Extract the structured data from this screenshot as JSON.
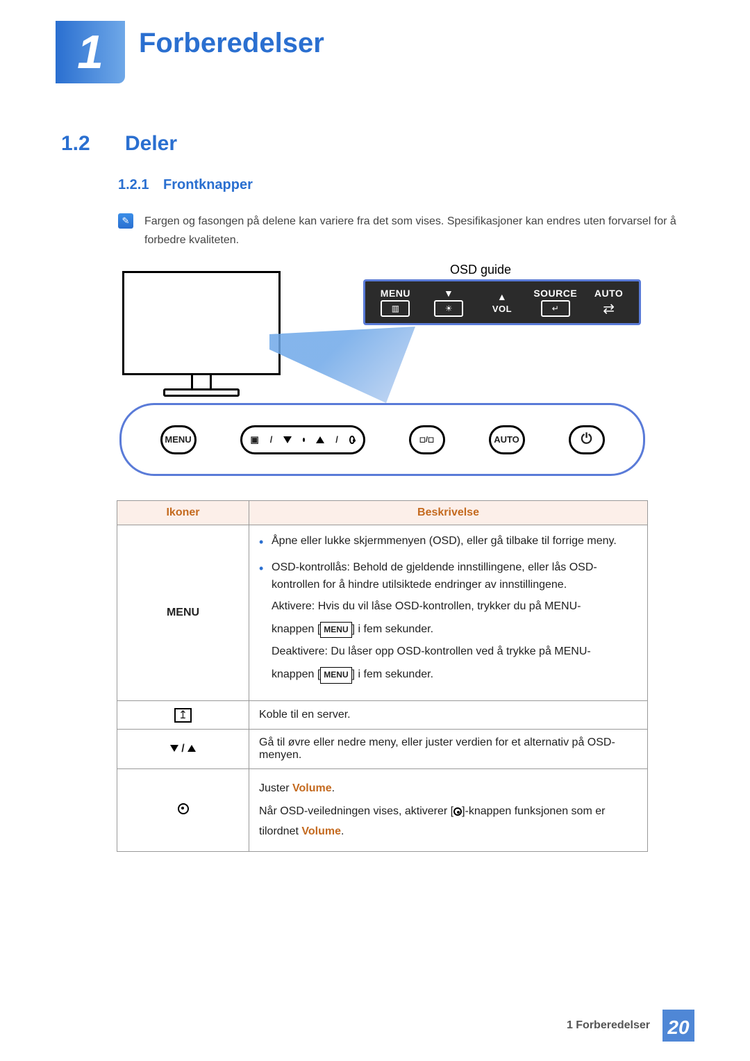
{
  "chapter": {
    "number": "1",
    "title": "Forberedelser"
  },
  "section": {
    "number": "1.2",
    "title": "Deler"
  },
  "subsection": {
    "number": "1.2.1",
    "title": "Frontknapper"
  },
  "note": "Fargen og fasongen på delene kan variere fra det som vises. Spesifikasjoner kan endres uten forvarsel for å forbedre kvaliteten.",
  "diagram": {
    "osd_label": "OSD guide",
    "osd_bar": {
      "menu": "MENU",
      "vol": "VOL",
      "source": "SOURCE",
      "auto": "AUTO"
    },
    "panel": {
      "menu": "MENU",
      "auto": "AUTO"
    }
  },
  "table": {
    "headers": {
      "icons": "Ikoner",
      "desc": "Beskrivelse"
    },
    "rows": {
      "menu": {
        "icon": "MENU",
        "bullet1": "Åpne eller lukke skjermmenyen (OSD), eller gå tilbake til forrige meny.",
        "bullet2": "OSD-kontrollås: Behold de gjeldende innstillingene, eller lås OSD-kontrollen for å hindre utilsiktede endringer av innstillingene.",
        "p1a": "Aktivere: Hvis du vil låse OSD-kontrollen, trykker du på MENU-",
        "p1b_prefix": "knappen [",
        "p1b_badge": "MENU",
        "p1b_suffix": "] i fem sekunder.",
        "p2a": "Deaktivere: Du låser opp OSD-kontrollen ved å trykke på MENU-",
        "p2b_prefix": "knappen [",
        "p2b_badge": "MENU",
        "p2b_suffix": "] i fem sekunder."
      },
      "server": {
        "text": "Koble til en server."
      },
      "arrows": {
        "text": "Gå til øvre eller nedre meny, eller juster verdien for et alternativ på OSD-menyen."
      },
      "volume": {
        "p1_prefix": "Juster ",
        "p1_vol": "Volume",
        "p1_suffix": ".",
        "p2_prefix": "Når OSD-veiledningen vises, aktiverer [",
        "p2_mid": "]-knappen funksjonen som er tilordnet ",
        "p2_vol": "Volume",
        "p2_suffix": "."
      }
    }
  },
  "footer": {
    "text": "1 Forberedelser",
    "page": "20"
  }
}
